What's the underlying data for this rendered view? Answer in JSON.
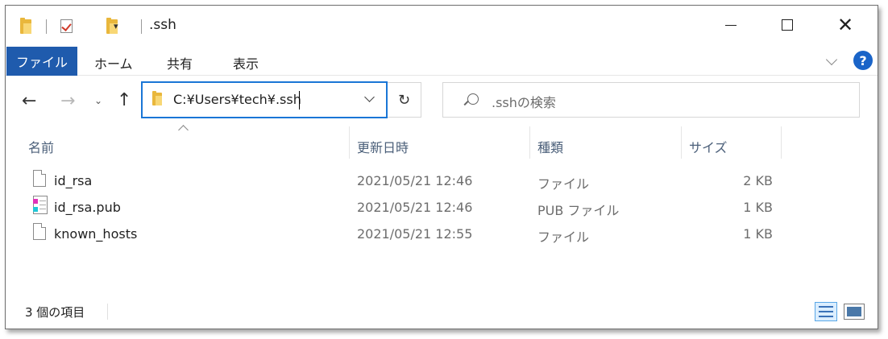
{
  "window": {
    "title": ".ssh"
  },
  "ribbon": {
    "tabs": [
      "ファイル",
      "ホーム",
      "共有",
      "表示"
    ]
  },
  "address_bar": {
    "path": "C:¥Users¥tech¥.ssh"
  },
  "search": {
    "placeholder": ".sshの検索"
  },
  "columns": [
    "名前",
    "更新日時",
    "種類",
    "サイズ"
  ],
  "files": [
    {
      "name": "id_rsa",
      "modified": "2021/05/21 12:46",
      "type": "ファイル",
      "size": "2 KB",
      "icon": "file-icon"
    },
    {
      "name": "id_rsa.pub",
      "modified": "2021/05/21 12:46",
      "type": "PUB ファイル",
      "size": "1 KB",
      "icon": "pub-file-icon"
    },
    {
      "name": "known_hosts",
      "modified": "2021/05/21 12:55",
      "type": "ファイル",
      "size": "1 KB",
      "icon": "file-icon"
    }
  ],
  "status_bar": {
    "item_count": "3 個の項目"
  },
  "colors": {
    "file_tab": "#1f5bad",
    "address_focus_border": "#1a76d6",
    "help_icon": "#1a64c8",
    "column_header_text": "#4c607a",
    "folder": "#e9b73c"
  }
}
